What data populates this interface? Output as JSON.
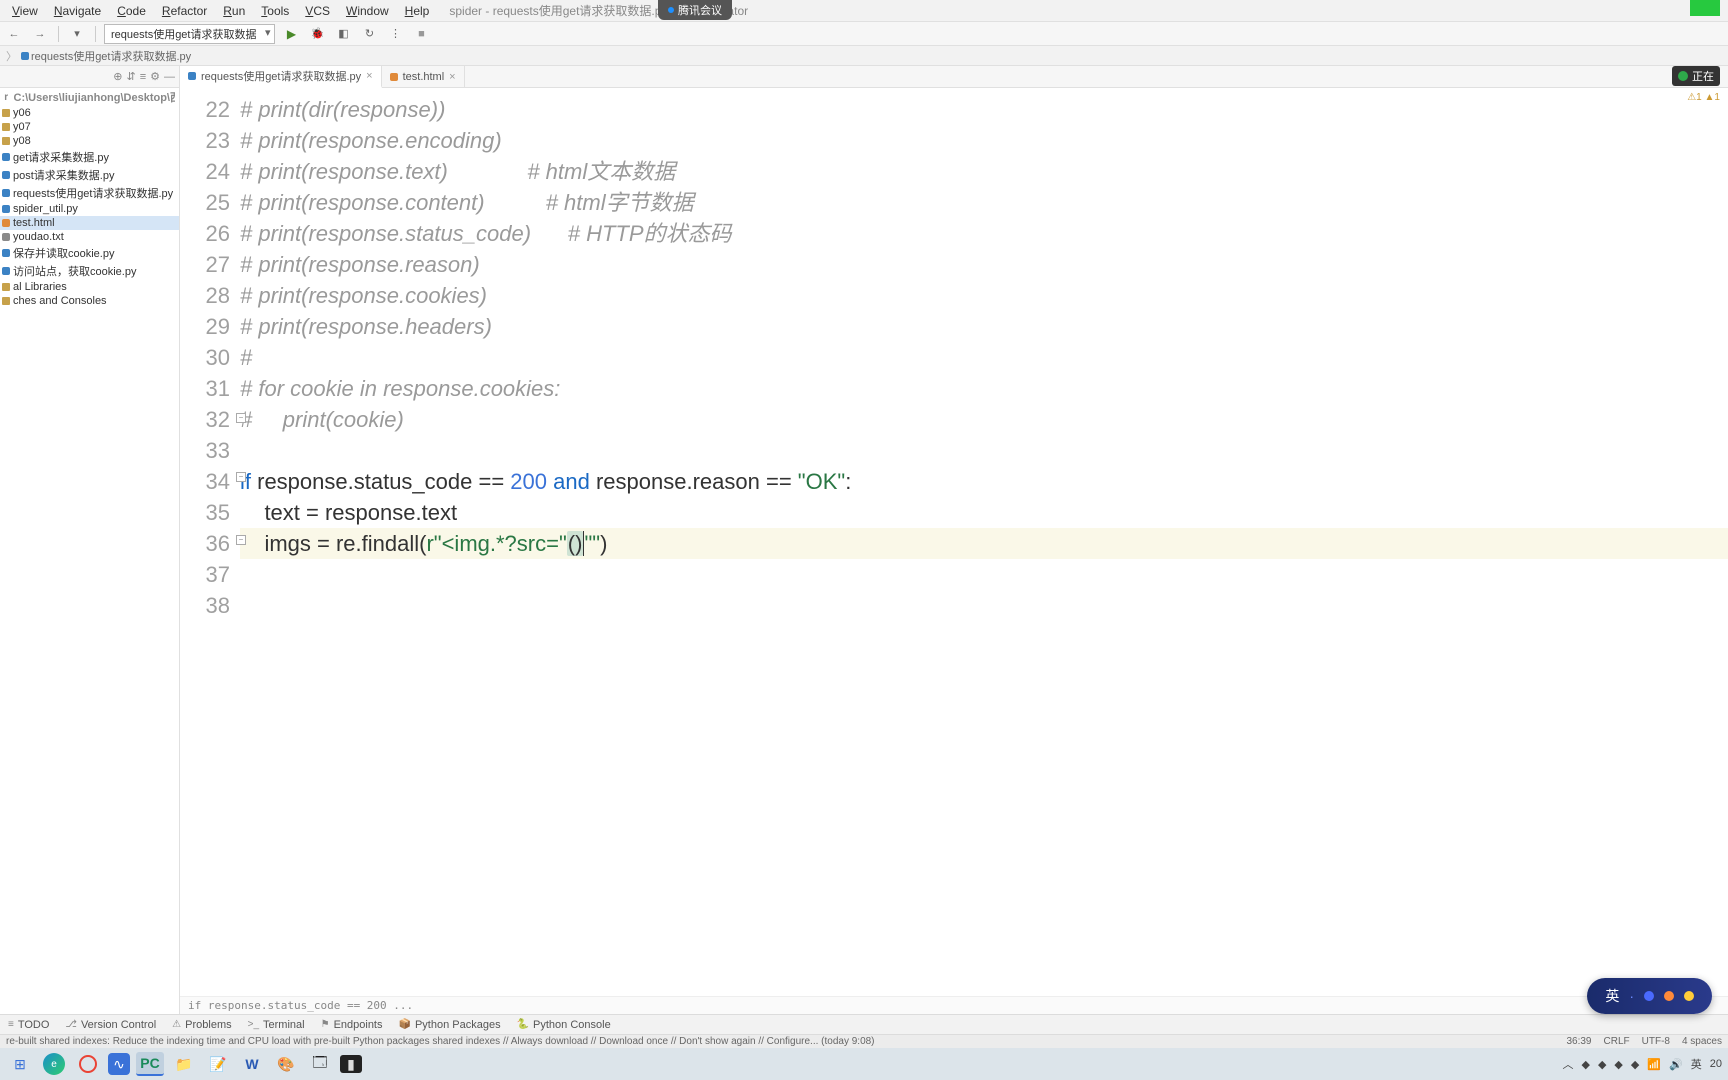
{
  "menubar": {
    "items": [
      "View",
      "Navigate",
      "Code",
      "Refactor",
      "Run",
      "Tools",
      "VCS",
      "Window",
      "Help"
    ],
    "title": "spider - requests使用get请求获取数据.py - Administrator"
  },
  "meeting_bar": {
    "label": "腾讯会议"
  },
  "toolbar": {
    "run_config": "requests使用get请求获取数据"
  },
  "breadcrumb": {
    "items": [
      "requests使用get请求获取数据.py"
    ]
  },
  "sidebar": {
    "root": "C:\\Users\\liujianhong\\Desktop\\西工程",
    "items": [
      {
        "icon": "fld",
        "label": "y06"
      },
      {
        "icon": "fld",
        "label": "y07"
      },
      {
        "icon": "fld",
        "label": "y08"
      },
      {
        "icon": "py",
        "label": "get请求采集数据.py"
      },
      {
        "icon": "py",
        "label": "post请求采集数据.py"
      },
      {
        "icon": "py",
        "label": "requests使用get请求获取数据.py"
      },
      {
        "icon": "py",
        "label": "spider_util.py"
      },
      {
        "icon": "html",
        "label": "test.html",
        "sel": true
      },
      {
        "icon": "txt",
        "label": "youdao.txt"
      },
      {
        "icon": "py",
        "label": "保存并读取cookie.py"
      },
      {
        "icon": "py",
        "label": "访问站点，获取cookie.py"
      },
      {
        "icon": "fld",
        "label": "al Libraries"
      },
      {
        "icon": "fld",
        "label": "ches and Consoles"
      }
    ]
  },
  "tabs": [
    {
      "icon": "py",
      "label": "requests使用get请求获取数据.py",
      "active": true
    },
    {
      "icon": "html",
      "label": "test.html",
      "active": false
    }
  ],
  "mic": {
    "label": "正在"
  },
  "warn": {
    "a": "⚠1",
    "b": "▲1"
  },
  "gutter_start": 22,
  "gutter_count": 17,
  "code_lines": [
    {
      "n": 22,
      "html": "<span class='cmt'># print(dir(response))</span>"
    },
    {
      "n": 23,
      "html": "<span class='cmt'># print(response.encoding)</span>"
    },
    {
      "n": 24,
      "html": "<span class='cmt'># print(response.text)             # html文本数据</span>"
    },
    {
      "n": 25,
      "html": "<span class='cmt'># print(response.content)          # html字节数据</span>"
    },
    {
      "n": 26,
      "html": "<span class='cmt'># print(response.status_code)      # HTTP的状态码</span>"
    },
    {
      "n": 27,
      "html": "<span class='cmt'># print(response.reason)</span>"
    },
    {
      "n": 28,
      "html": "<span class='cmt'># print(response.cookies)</span>"
    },
    {
      "n": 29,
      "html": "<span class='cmt'># print(response.headers)</span>"
    },
    {
      "n": 30,
      "html": "<span class='cmt'>#</span>"
    },
    {
      "n": 31,
      "html": "<span class='cmt'># for cookie in response.cookies:</span>"
    },
    {
      "n": 32,
      "html": "<span class='cmt'>#     print(cookie)</span>"
    },
    {
      "n": 33,
      "html": ""
    },
    {
      "n": 34,
      "html": "<span class='kw'>if</span> response.status_code == <span class='num'>200</span> <span class='kw'>and</span> response.reason == <span class='str'>\"OK\"</span>:"
    },
    {
      "n": 35,
      "html": "    text = response.text"
    },
    {
      "n": 36,
      "cur": true,
      "html": "    imgs = re.findall(<span class='str'>r\"&lt;img.*?src=\"</span><span class='hilite'>()</span><span class='caret'></span><span class='str'>\"\"</span>)"
    },
    {
      "n": 37,
      "html": ""
    },
    {
      "n": 38,
      "html": ""
    }
  ],
  "breadcrumb2": "if response.status_code == 200 ...",
  "bottom_tabs": [
    "TODO",
    "Version Control",
    "Problems",
    "Terminal",
    "Endpoints",
    "Python Packages",
    "Python Console"
  ],
  "statusbar": {
    "left": "re-built shared indexes: Reduce the indexing time and CPU load with pre-built Python packages shared indexes // Always download // Download once // Don't show again // Configure... (today 9:08)",
    "right": [
      "36:39",
      "CRLF",
      "UTF-8",
      "4 spaces"
    ]
  },
  "ime": {
    "lang": "英",
    "icons": [
      "☾",
      "👕",
      "★"
    ]
  },
  "tray": {
    "ime": "英",
    "time": "20"
  }
}
